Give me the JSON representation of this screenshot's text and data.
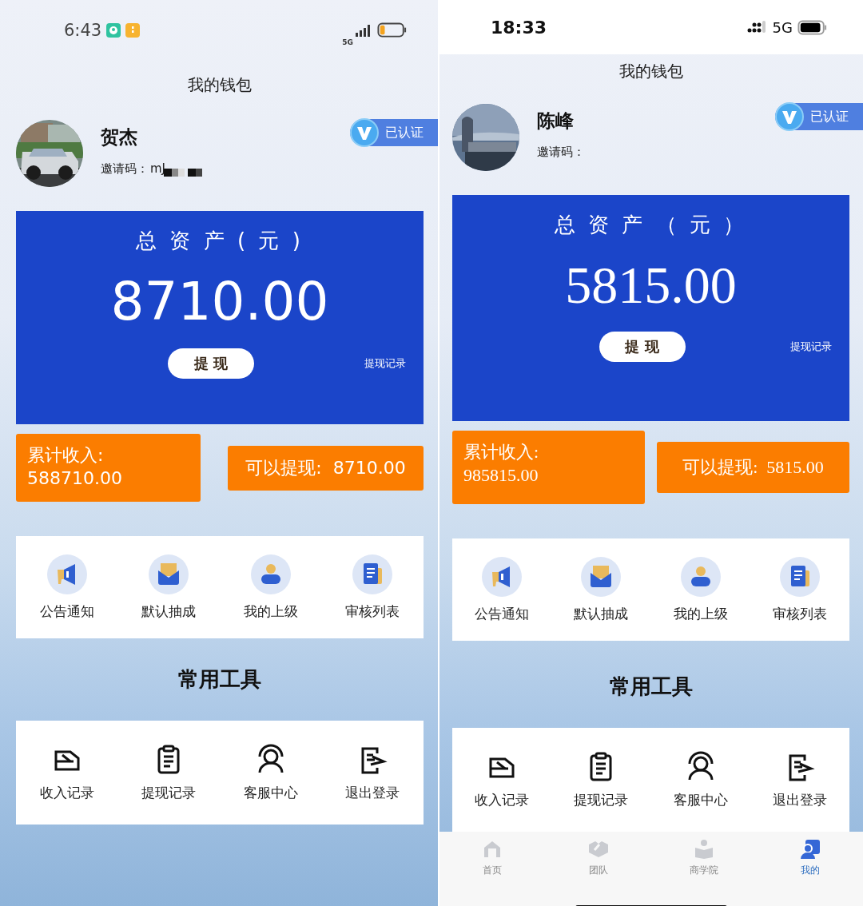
{
  "phones": [
    {
      "status_bar": {
        "kind": "android",
        "time": "6:43",
        "network": "5G"
      },
      "title": "我的钱包",
      "profile": {
        "name": "贺杰",
        "invite_label": "邀请码：",
        "invite_code": "mJ",
        "redacted": true,
        "verified": "已认证"
      },
      "asset": {
        "label": "总 资 产 ( 元 )",
        "amount": "8710.00",
        "withdraw_button": "提 现",
        "history_link": "提现记录"
      },
      "income": {
        "label": "累计收入:",
        "value": "588710.00"
      },
      "available": "可以提现:  8710.00",
      "shortcuts": [
        {
          "kind": "megaphone",
          "label": "公告通知"
        },
        {
          "kind": "envelope",
          "label": "默认抽成"
        },
        {
          "kind": "person",
          "label": "我的上级"
        },
        {
          "kind": "document",
          "label": "审核列表"
        }
      ],
      "tools_title": "常用工具",
      "tools": [
        {
          "kind": "tray",
          "label": "收入记录"
        },
        {
          "kind": "clipboard",
          "label": "提现记录"
        },
        {
          "kind": "headset",
          "label": "客服中心"
        },
        {
          "kind": "logout",
          "label": "退出登录"
        }
      ]
    },
    {
      "status_bar": {
        "kind": "ios",
        "time": "18:33",
        "network": "5G"
      },
      "title": "我的钱包",
      "profile": {
        "name": "陈峰",
        "invite_label": "邀请码：",
        "verified": "已认证"
      },
      "asset": {
        "label": "总 资 产 （ 元 ）",
        "amount": "5815.00",
        "withdraw_button": "提 现",
        "history_link": "提现记录"
      },
      "income": {
        "label": "累计收入:",
        "value": "985815.00"
      },
      "available": "可以提现:  5815.00",
      "shortcuts": [
        {
          "kind": "megaphone",
          "label": "公告通知"
        },
        {
          "kind": "envelope",
          "label": "默认抽成"
        },
        {
          "kind": "person",
          "label": "我的上级"
        },
        {
          "kind": "document",
          "label": "审核列表"
        }
      ],
      "tools_title": "常用工具",
      "tools": [
        {
          "kind": "tray",
          "label": "收入记录"
        },
        {
          "kind": "clipboard",
          "label": "提现记录"
        },
        {
          "kind": "headset",
          "label": "客服中心"
        },
        {
          "kind": "logout",
          "label": "退出登录"
        }
      ],
      "tab_bar": [
        {
          "kind": "home",
          "label": "首页",
          "selected": false
        },
        {
          "kind": "handshake",
          "label": "团队",
          "selected": false
        },
        {
          "kind": "school",
          "label": "商学院",
          "selected": false
        },
        {
          "kind": "me",
          "label": "我的",
          "selected": true
        }
      ]
    }
  ]
}
